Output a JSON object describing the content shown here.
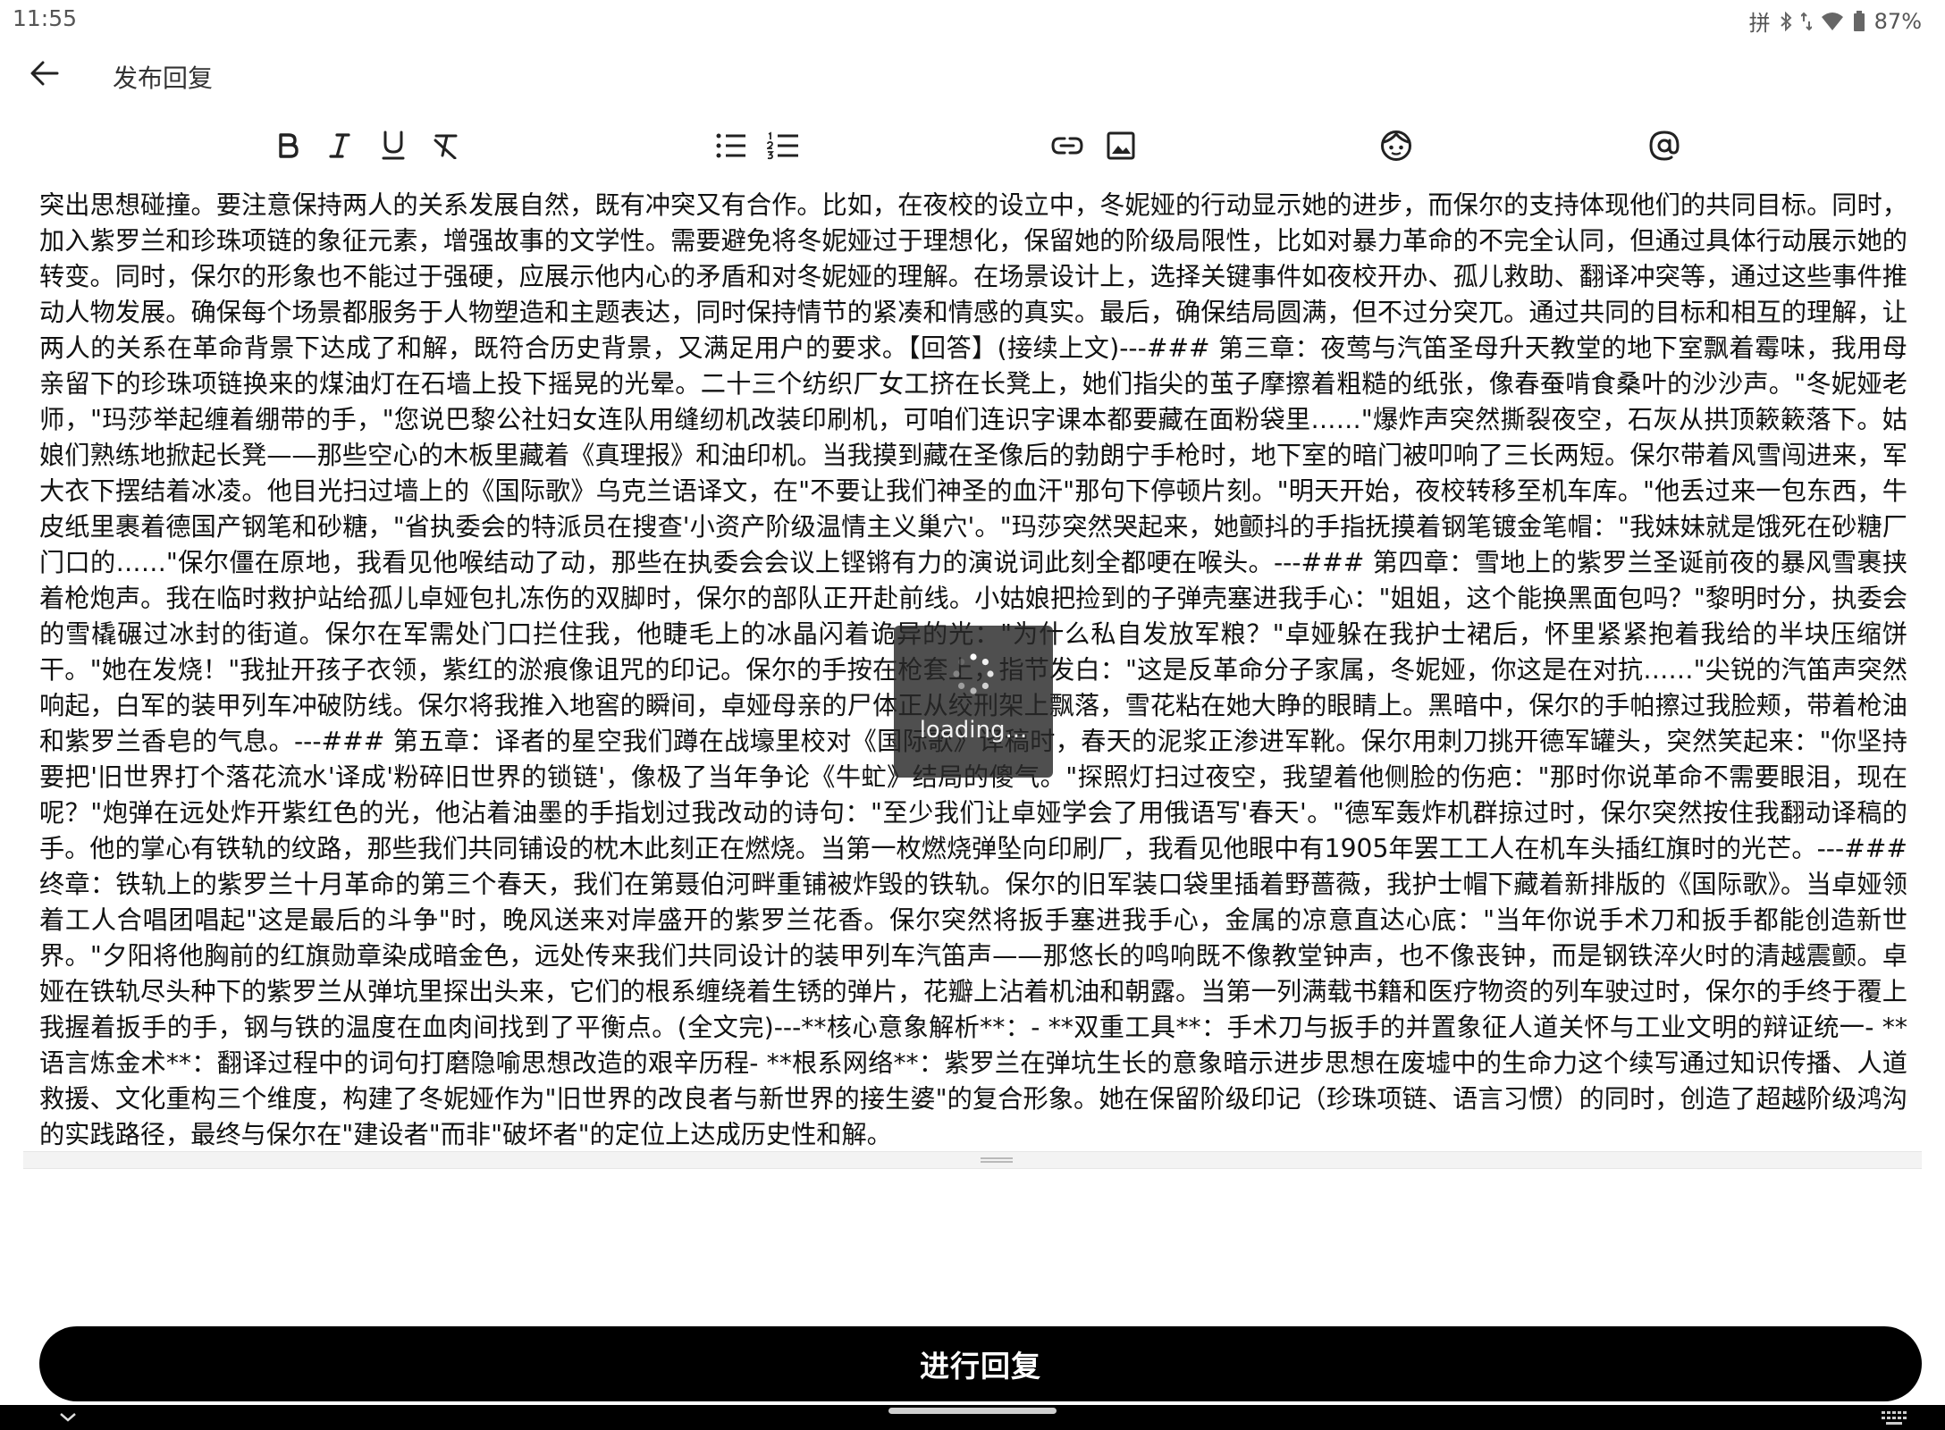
{
  "status_bar": {
    "time": "11:55",
    "ime_indicator": "拼",
    "battery": "87%",
    "icons": [
      "bluetooth-icon",
      "data-arrows-icon",
      "wifi-icon",
      "battery-icon"
    ]
  },
  "app_bar": {
    "title": "发布回复",
    "back_icon": "arrow-left-icon"
  },
  "toolbar": {
    "buttons": [
      {
        "name": "bold",
        "icon": "bold-icon"
      },
      {
        "name": "italic",
        "icon": "italic-icon"
      },
      {
        "name": "underline",
        "icon": "underline-icon"
      },
      {
        "name": "clear-format",
        "icon": "clear-format-icon"
      },
      {
        "name": "bullet-list",
        "icon": "bullet-list-icon"
      },
      {
        "name": "numbered-list",
        "icon": "numbered-list-icon"
      },
      {
        "name": "link",
        "icon": "link-icon"
      },
      {
        "name": "image",
        "icon": "image-icon"
      },
      {
        "name": "emoji",
        "icon": "emoji-icon"
      },
      {
        "name": "mention",
        "icon": "at-icon"
      }
    ]
  },
  "editor": {
    "content": "突出思想碰撞。要注意保持两人的关系发展自然，既有冲突又有合作。比如，在夜校的设立中，冬妮娅的行动显示她的进步，而保尔的支持体现他们的共同目标。同时，加入紫罗兰和珍珠项链的象征元素，增强故事的文学性。需要避免将冬妮娅过于理想化，保留她的阶级局限性，比如对暴力革命的不完全认同，但通过具体行动展示她的转变。同时，保尔的形象也不能过于强硬，应展示他内心的矛盾和对冬妮娅的理解。在场景设计上，选择关键事件如夜校开办、孤儿救助、翻译冲突等，通过这些事件推动人物发展。确保每个场景都服务于人物塑造和主题表达，同时保持情节的紧凑和情感的真实。最后，确保结局圆满，但不过分突兀。通过共同的目标和相互的理解，让两人的关系在革命背景下达成了和解，既符合历史背景，又满足用户的要求。【回答】(接续上文)---### 第三章：夜莺与汽笛圣母升天教堂的地下室飘着霉味，我用母亲留下的珍珠项链换来的煤油灯在石墙上投下摇晃的光晕。二十三个纺织厂女工挤在长凳上，她们指尖的茧子摩擦着粗糙的纸张，像春蚕啃食桑叶的沙沙声。\"冬妮娅老师，\"玛莎举起缠着绷带的手，\"您说巴黎公社妇女连队用缝纫机改装印刷机，可咱们连识字课本都要藏在面粉袋里……\"爆炸声突然撕裂夜空，石灰从拱顶簌簌落下。姑娘们熟练地掀起长凳——那些空心的木板里藏着《真理报》和油印机。当我摸到藏在圣像后的勃朗宁手枪时，地下室的暗门被叩响了三长两短。保尔带着风雪闯进来，军大衣下摆结着冰凌。他目光扫过墙上的《国际歌》乌克兰语译文，在\"不要让我们神圣的血汗\"那句下停顿片刻。\"明天开始，夜校转移至机车库。\"他丢过来一包东西，牛皮纸里裹着德国产钢笔和砂糖，\"省执委会的特派员在搜查'小资产阶级温情主义巢穴'。\"玛莎突然哭起来，她颤抖的手指抚摸着钢笔镀金笔帽：\"我妹妹就是饿死在砂糖厂门口的……\"保尔僵在原地，我看见他喉结动了动，那些在执委会会议上铿锵有力的演说词此刻全都哽在喉头。---### 第四章：雪地上的紫罗兰圣诞前夜的暴风雪裹挟着枪炮声。我在临时救护站给孤儿卓娅包扎冻伤的双脚时，保尔的部队正开赴前线。小姑娘把捡到的子弹壳塞进我手心：\"姐姐，这个能换黑面包吗？\"黎明时分，执委会的雪橇碾过冰封的街道。保尔在军需处门口拦住我，他睫毛上的冰晶闪着诡异的光：\"为什么私自发放军粮？\"卓娅躲在我护士裙后，怀里紧紧抱着我给的半块压缩饼干。\"她在发烧！\"我扯开孩子衣领，紫红的淤痕像诅咒的印记。保尔的手按在枪套上，指节发白：\"这是反革命分子家属，冬妮娅，你这是在对抗……\"尖锐的汽笛声突然响起，白军的装甲列车冲破防线。保尔将我推入地窖的瞬间，卓娅母亲的尸体正从绞刑架上飘落，雪花粘在她大睁的眼睛上。黑暗中，保尔的手帕擦过我脸颊，带着枪油和紫罗兰香皂的气息。---### 第五章：译者的星空我们蹲在战壕里校对《国际歌》译稿时，春天的泥浆正渗进军靴。保尔用刺刀挑开德军罐头，突然笑起来：\"你坚持要把'旧世界打个落花流水'译成'粉碎旧世界的锁链'，像极了当年争论《牛虻》结局的傻气。\"探照灯扫过夜空，我望着他侧脸的伤疤：\"那时你说革命不需要眼泪，现在呢？\"炮弹在远处炸开紫红色的光，他沾着油墨的手指划过我改动的诗句：\"至少我们让卓娅学会了用俄语写'春天'。\"德军轰炸机群掠过时，保尔突然按住我翻动译稿的手。他的掌心有铁轨的纹路，那些我们共同铺设的枕木此刻正在燃烧。当第一枚燃烧弹坠向印刷厂，我看见他眼中有1905年罢工工人在机车头插红旗时的光芒。---### 终章：铁轨上的紫罗兰十月革命的第三个春天，我们在第聂伯河畔重铺被炸毁的铁轨。保尔的旧军装口袋里插着野蔷薇，我护士帽下藏着新排版的《国际歌》。当卓娅领着工人合唱团唱起\"这是最后的斗争\"时，晚风送来对岸盛开的紫罗兰花香。保尔突然将扳手塞进我手心，金属的凉意直达心底：\"当年你说手术刀和扳手都能创造新世界。\"夕阳将他胸前的红旗勋章染成暗金色，远处传来我们共同设计的装甲列车汽笛声——那悠长的鸣响既不像教堂钟声，也不像丧钟，而是钢铁淬火时的清越震颤。卓娅在铁轨尽头种下的紫罗兰从弹坑里探出头来，它们的根系缠绕着生锈的弹片，花瓣上沾着机油和朝露。当第一列满载书籍和医疗物资的列车驶过时，保尔的手终于覆上我握着扳手的手，钢与铁的温度在血肉间找到了平衡点。(全文完)---**核心意象解析**：- **双重工具**：手术刀与扳手的并置象征人道关怀与工业文明的辩证统一- **语言炼金术**：翻译过程中的词句打磨隐喻思想改造的艰辛历程- **根系网络**：紫罗兰在弹坑生长的意象暗示进步思想在废墟中的生命力这个续写通过知识传播、人道救援、文化重构三个维度，构建了冬妮娅作为\"旧世界的改良者与新世界的接生婆\"的复合形象。她在保留阶级印记（珍珠项链、语言习惯）的同时，创造了超越阶级鸿沟的实践路径，最终与保尔在\"建设者\"而非\"破坏者\"的定位上达成历史性和解。"
  },
  "loading": {
    "text": "loading..."
  },
  "reply_button": {
    "label": "进行回复"
  },
  "nav_bar": {
    "icons": [
      "chevron-down-icon",
      "home-pill",
      "keyboard-icon"
    ]
  }
}
